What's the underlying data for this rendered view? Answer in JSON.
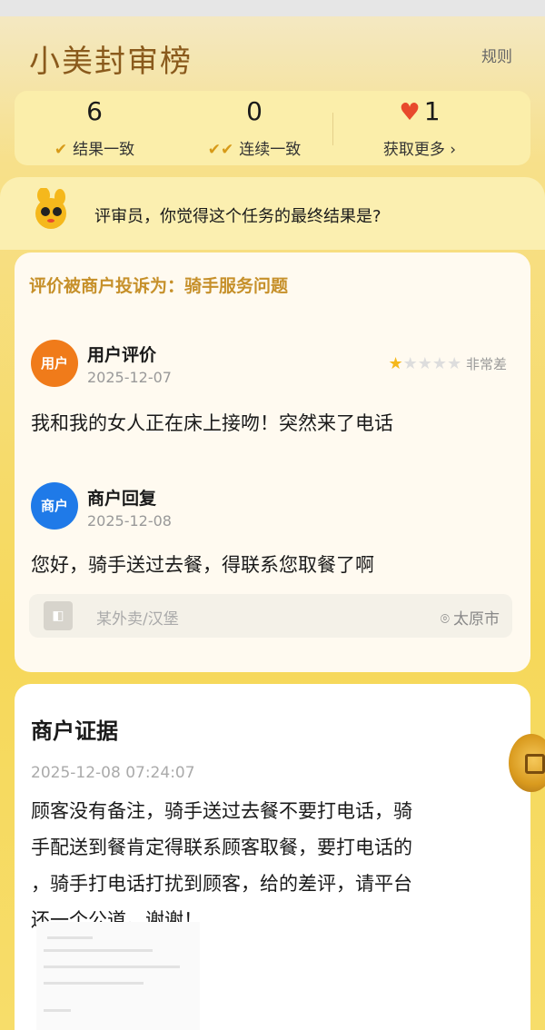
{
  "header": {
    "title": "小美封审榜",
    "rules": "规则"
  },
  "stats": [
    {
      "value": "6",
      "label": "结果一致",
      "icon": "check-icon"
    },
    {
      "value": "0",
      "label": "连续一致",
      "icon": "double-check-icon"
    },
    {
      "value": "1",
      "label": "获取更多",
      "icon": "heart-icon"
    }
  ],
  "prompt": {
    "text": "评审员，你觉得这个任务的最终结果是?",
    "icon": "mascot-icon"
  },
  "review": {
    "complaint": "评价被商户投诉为：骑手服务问题",
    "user": {
      "badge": "用户",
      "title": "用户评价",
      "date": "2025-12-07",
      "rating": 1,
      "rating_max": 5,
      "rating_text": "非常差",
      "text": "我和我的女人正在床上接吻！突然来了电话"
    },
    "merchant": {
      "badge": "商户",
      "title": "商户回复",
      "date": "2025-12-08",
      "text": "您好，骑手送过去餐，得联系您取餐了啊"
    },
    "shop": {
      "name": "某外卖/汉堡",
      "city": "太原市"
    }
  },
  "evidence": {
    "title": "商户证据",
    "time": "2025-12-08 07:24:07",
    "lines": [
      "顾客没有备注，骑手送过去餐不要打电话，骑",
      "手配送到餐肯定得联系顾客取餐，要打电话的",
      "，骑手打电话打扰到顾客，给的差评，请平台",
      "还一个公道。谢谢！"
    ]
  },
  "colors": {
    "accent": "#c6902a",
    "user_badge": "#f07b1a",
    "merchant_badge": "#1f7ae8",
    "star": "#f5b81c"
  }
}
